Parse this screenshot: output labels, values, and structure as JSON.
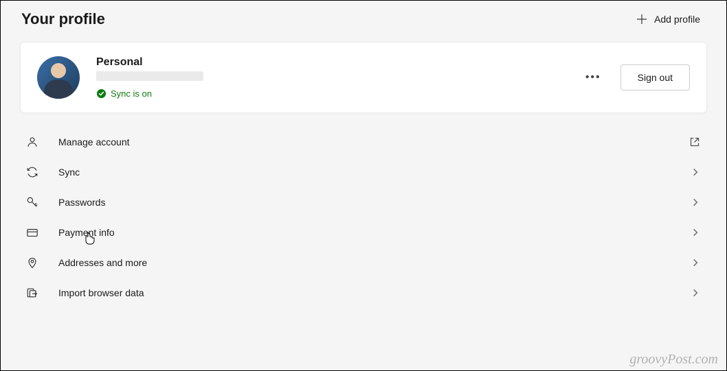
{
  "header": {
    "title": "Your profile",
    "add_profile_label": "Add profile"
  },
  "profile": {
    "name": "Personal",
    "sync_status": "Sync is on",
    "sign_out_label": "Sign out"
  },
  "settings": {
    "manage_account": "Manage account",
    "sync": "Sync",
    "passwords": "Passwords",
    "payment_info": "Payment info",
    "addresses": "Addresses and more",
    "import_data": "Import browser data"
  },
  "watermark": "groovyPost.com"
}
